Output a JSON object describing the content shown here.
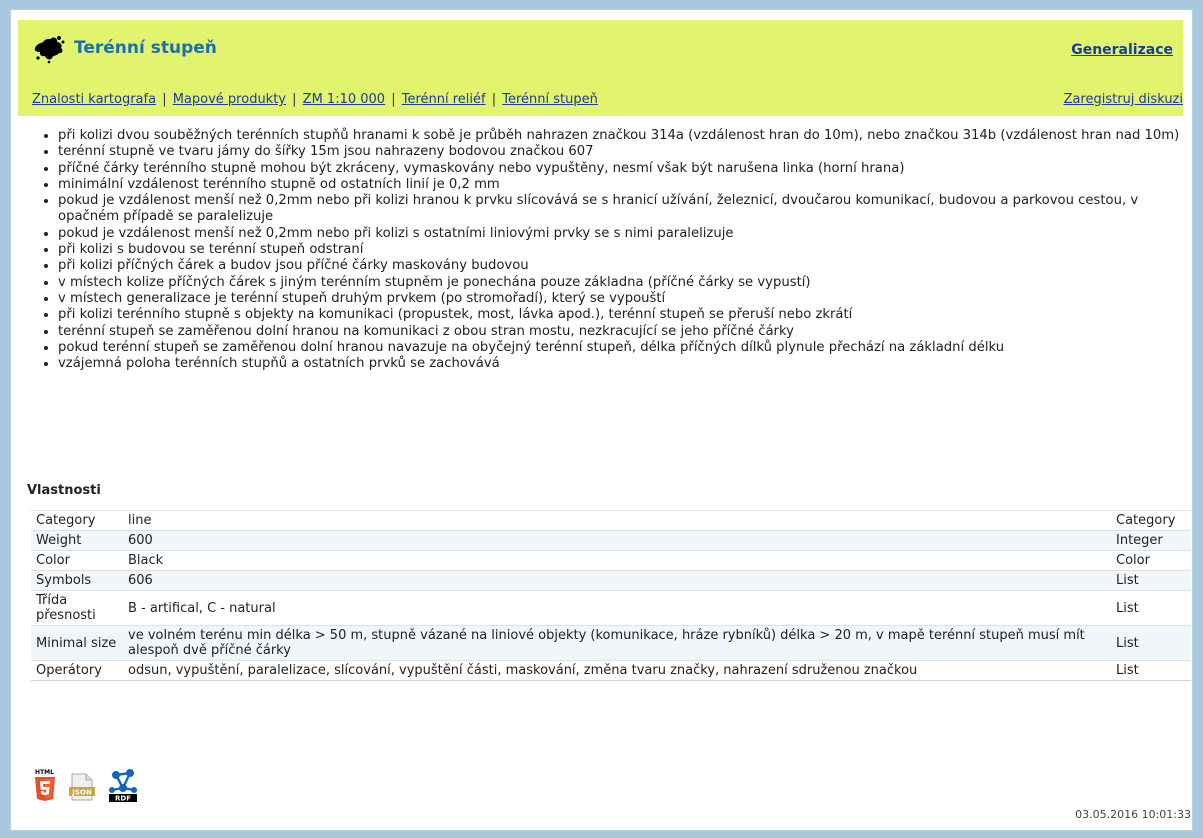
{
  "header": {
    "title": "Terénní stupeň",
    "generalization_link": "Generalizace",
    "register_link": "Zaregistruj diskuzi",
    "breadcrumb": [
      "Znalosti kartografa",
      "Mapové produkty",
      "ZM 1:10 000",
      "Terénní reliéf",
      "Terénní stupeň"
    ]
  },
  "rules": [
    "při kolizi dvou souběžných terénních stupňů hranami k sobě je průběh nahrazen značkou 314a (vzdálenost hran do 10m), nebo značkou 314b (vzdálenost hran nad 10m)",
    "terénní stupně ve tvaru jámy do šířky 15m jsou nahrazeny bodovou značkou 607",
    "příčné čárky terénního stupně mohou být zkráceny, vymaskovány nebo vypuštěny, nesmí však být narušena linka (horní hrana)",
    "minimální vzdálenost terénního stupně od ostatních linií je 0,2 mm",
    "pokud je vzdálenost menší než 0,2mm nebo při kolizi hranou k prvku slícovává se s hranicí užívání, železnicí, dvoučarou komunikací, budovou a parkovou cestou, v opačném případě se paralelizuje",
    "pokud je vzdálenost menší než 0,2mm nebo při kolizi s ostatními liniovými prvky se s nimi paralelizuje",
    "při kolizi s budovou se terénní stupeň odstraní",
    "při kolizi příčných čárek a budov jsou příčné čárky maskovány budovou",
    "v místech kolize příčných čárek s jiným terénním stupněm je ponechána pouze základna (příčné čárky se vypustí)",
    "v místech generalizace je terénní stupeň druhým prvkem (po stromořadí), který se vypouští",
    "při kolizi terénního stupně s objekty na komunikaci (propustek, most, lávka apod.), terénní stupeň se přeruší nebo zkrátí",
    "terénní stupeň se zaměřenou dolní hranou na komunikaci z obou stran mostu, nezkracující se jeho příčné čárky",
    "pokud terénní stupeň se zaměřenou dolní hranou navazuje na obyčejný terénní stupeň, délka příčných dílků plynule přechází na základní délku",
    "vzájemná poloha terénních stupňů a ostatních prvků se zachovává"
  ],
  "properties": {
    "heading": "Vlastnosti",
    "rows": [
      {
        "key": "Category",
        "value": "line",
        "type": "Category"
      },
      {
        "key": "Weight",
        "value": "600",
        "type": "Integer"
      },
      {
        "key": "Color",
        "value": "Black",
        "type": "Color"
      },
      {
        "key": "Symbols",
        "value": "606",
        "type": "List"
      },
      {
        "key": "Třída přesnosti",
        "value": "B - artifical, C - natural",
        "type": "List"
      },
      {
        "key": "Minimal size",
        "value": "ve volném terénu min délka > 50 m, stupně vázané na liniové objekty (komunikace, hráze rybníků) délka > 20 m, v mapě terénní stupeň musí mít alespoň dvě příčné čárky",
        "type": "List"
      },
      {
        "key": "Operátory",
        "value": "odsun, vypuštění, paralelizace, slícování, vypuštění části, maskování, změna tvaru značky, nahrazení sdruženou značkou",
        "type": "List"
      }
    ]
  },
  "export_icons": [
    {
      "name": "html5-icon",
      "label": "HTML"
    },
    {
      "name": "json-icon",
      "label": "JSON"
    },
    {
      "name": "rdf-icon",
      "label": "RDF"
    }
  ],
  "timestamp": "03.05.2016 10:01:33",
  "colors": {
    "header_bg": "#e2f36e",
    "title": "#1a6fb0",
    "link": "#1a3c9a"
  }
}
